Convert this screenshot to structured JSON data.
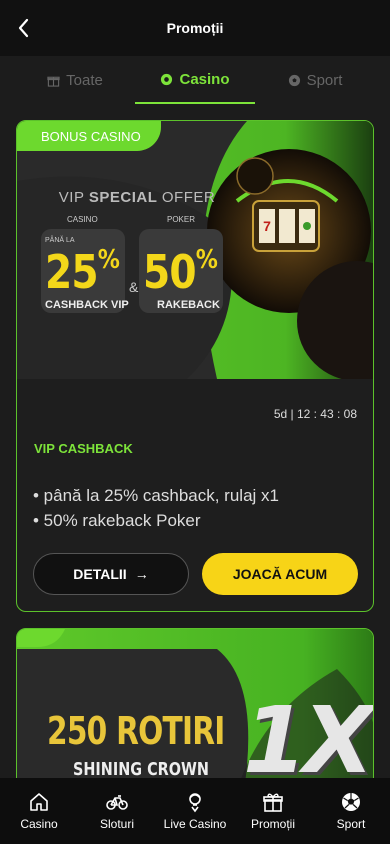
{
  "header": {
    "title": "Promoții"
  },
  "tabs": [
    {
      "label": "Toate",
      "icon": "gift-icon",
      "active": false
    },
    {
      "label": "Casino",
      "icon": "casino-chip-icon",
      "active": true
    },
    {
      "label": "Sport",
      "icon": "soccer-ball-icon",
      "active": false
    }
  ],
  "promo1": {
    "badge": "BONUS CASINO",
    "offer_title_1": "VIP",
    "offer_title_2": "SPECIAL",
    "offer_title_3": "OFFER",
    "casino_label": "CASINO",
    "upto_label": "PÂNĂ LA",
    "casino_value": "25",
    "casino_unit": "%",
    "casino_sub": "CASHBACK VIP",
    "amp": "&",
    "poker_label": "POKER",
    "poker_value": "50",
    "poker_unit": "%",
    "poker_sub": "RAKEBACK",
    "timer": "5d | 12 : 43 : 08",
    "title": "VIP CASHBACK",
    "bullet_1": "• până la 25% cashback, rulaj x1",
    "bullet_2": "• 50% rakeback Poker",
    "details_label": "DETALII",
    "details_arrow": "→",
    "play_label": "JOACĂ ACUM"
  },
  "promo2": {
    "headline": "250 ROTIRI",
    "game": "SHINING CROWN",
    "logo_text": "1X"
  },
  "bottom_nav": [
    {
      "label": "Casino",
      "icon": "home-icon"
    },
    {
      "label": "Sloturi",
      "icon": "bicycle-icon"
    },
    {
      "label": "Live Casino",
      "icon": "dealer-icon"
    },
    {
      "label": "Promoții",
      "icon": "gift-icon"
    },
    {
      "label": "Sport",
      "icon": "soccer-ball-icon"
    }
  ],
  "colors": {
    "accent_green": "#7de33a",
    "cta_yellow": "#f7d417",
    "background": "#1c1c1c"
  }
}
